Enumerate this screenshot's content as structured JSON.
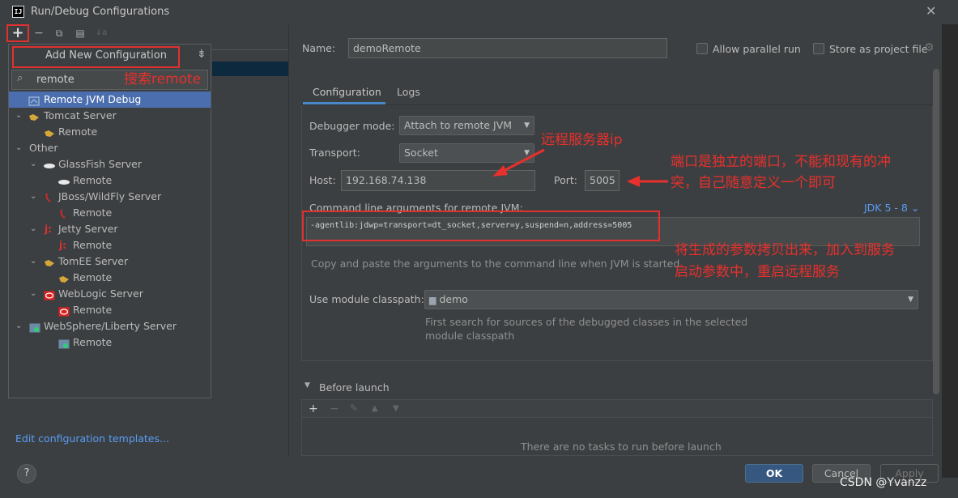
{
  "window": {
    "title": "Run/Debug Configurations",
    "app_icon_text": "IJ"
  },
  "toolbar": {
    "add": "+",
    "remove": "−",
    "copy": "⧉",
    "folder": "▤",
    "sort": "↓a"
  },
  "popup": {
    "title": "Add New Configuration",
    "search_value": "remote",
    "items": [
      {
        "label": "Remote JVM Debug"
      },
      {
        "label": "Tomcat Server"
      },
      {
        "label": "Remote"
      },
      {
        "label": "Other"
      },
      {
        "label": "GlassFish Server"
      },
      {
        "label": "Remote"
      },
      {
        "label": "JBoss/WildFly Server"
      },
      {
        "label": "Remote"
      },
      {
        "label": "Jetty Server"
      },
      {
        "label": "Remote"
      },
      {
        "label": "TomEE Server"
      },
      {
        "label": "Remote"
      },
      {
        "label": "WebLogic Server"
      },
      {
        "label": "Remote"
      },
      {
        "label": "WebSphere/Liberty Server"
      },
      {
        "label": "Remote"
      }
    ]
  },
  "left": {
    "edit_templates": "Edit configuration templates..."
  },
  "form": {
    "name_label": "Name:",
    "name_value": "demoRemote",
    "allow_parallel": "Allow parallel run",
    "store_as_project": "Store as project file",
    "tabs": [
      "Configuration",
      "Logs"
    ],
    "debugger_mode_label": "Debugger mode:",
    "debugger_mode_value": "Attach to remote JVM",
    "transport_label": "Transport:",
    "transport_value": "Socket",
    "host_label": "Host:",
    "host_value": "192.168.74.138",
    "port_label": "Port:",
    "port_value": "5005",
    "cmd_label": "Command line arguments for remote JVM:",
    "jdk_link": "JDK 5 - 8",
    "cmd_value": "-agentlib:jdwp=transport=dt_socket,server=y,suspend=n,address=5005",
    "cmd_hint": "Copy and paste the arguments to the command line when JVM is started",
    "module_label": "Use module classpath:",
    "module_value": "demo",
    "module_hint_1": "First search for sources of the debugged classes in the selected",
    "module_hint_2": "module classpath",
    "before_launch": "Before launch",
    "no_tasks": "There are no tasks to run before launch"
  },
  "buttons": {
    "help": "?",
    "ok": "OK",
    "cancel": "Cancel",
    "apply": "Apply"
  },
  "annotations": {
    "search": "搜索remote",
    "ip": "远程服务器ip",
    "port_1": "端口是独立的端口，不能和现有的冲",
    "port_2": "突，自己随意定义一个即可",
    "copy_1": "将生成的参数拷贝出来，加入到服务",
    "copy_2": "启动参数中，重启远程服务"
  },
  "watermark": "CSDN @Yvanzz",
  "colors": {
    "annotation_red": "#e8302c",
    "selection_blue": "#4b6eaf",
    "link_blue": "#589df6",
    "ok_blue": "#365880"
  }
}
